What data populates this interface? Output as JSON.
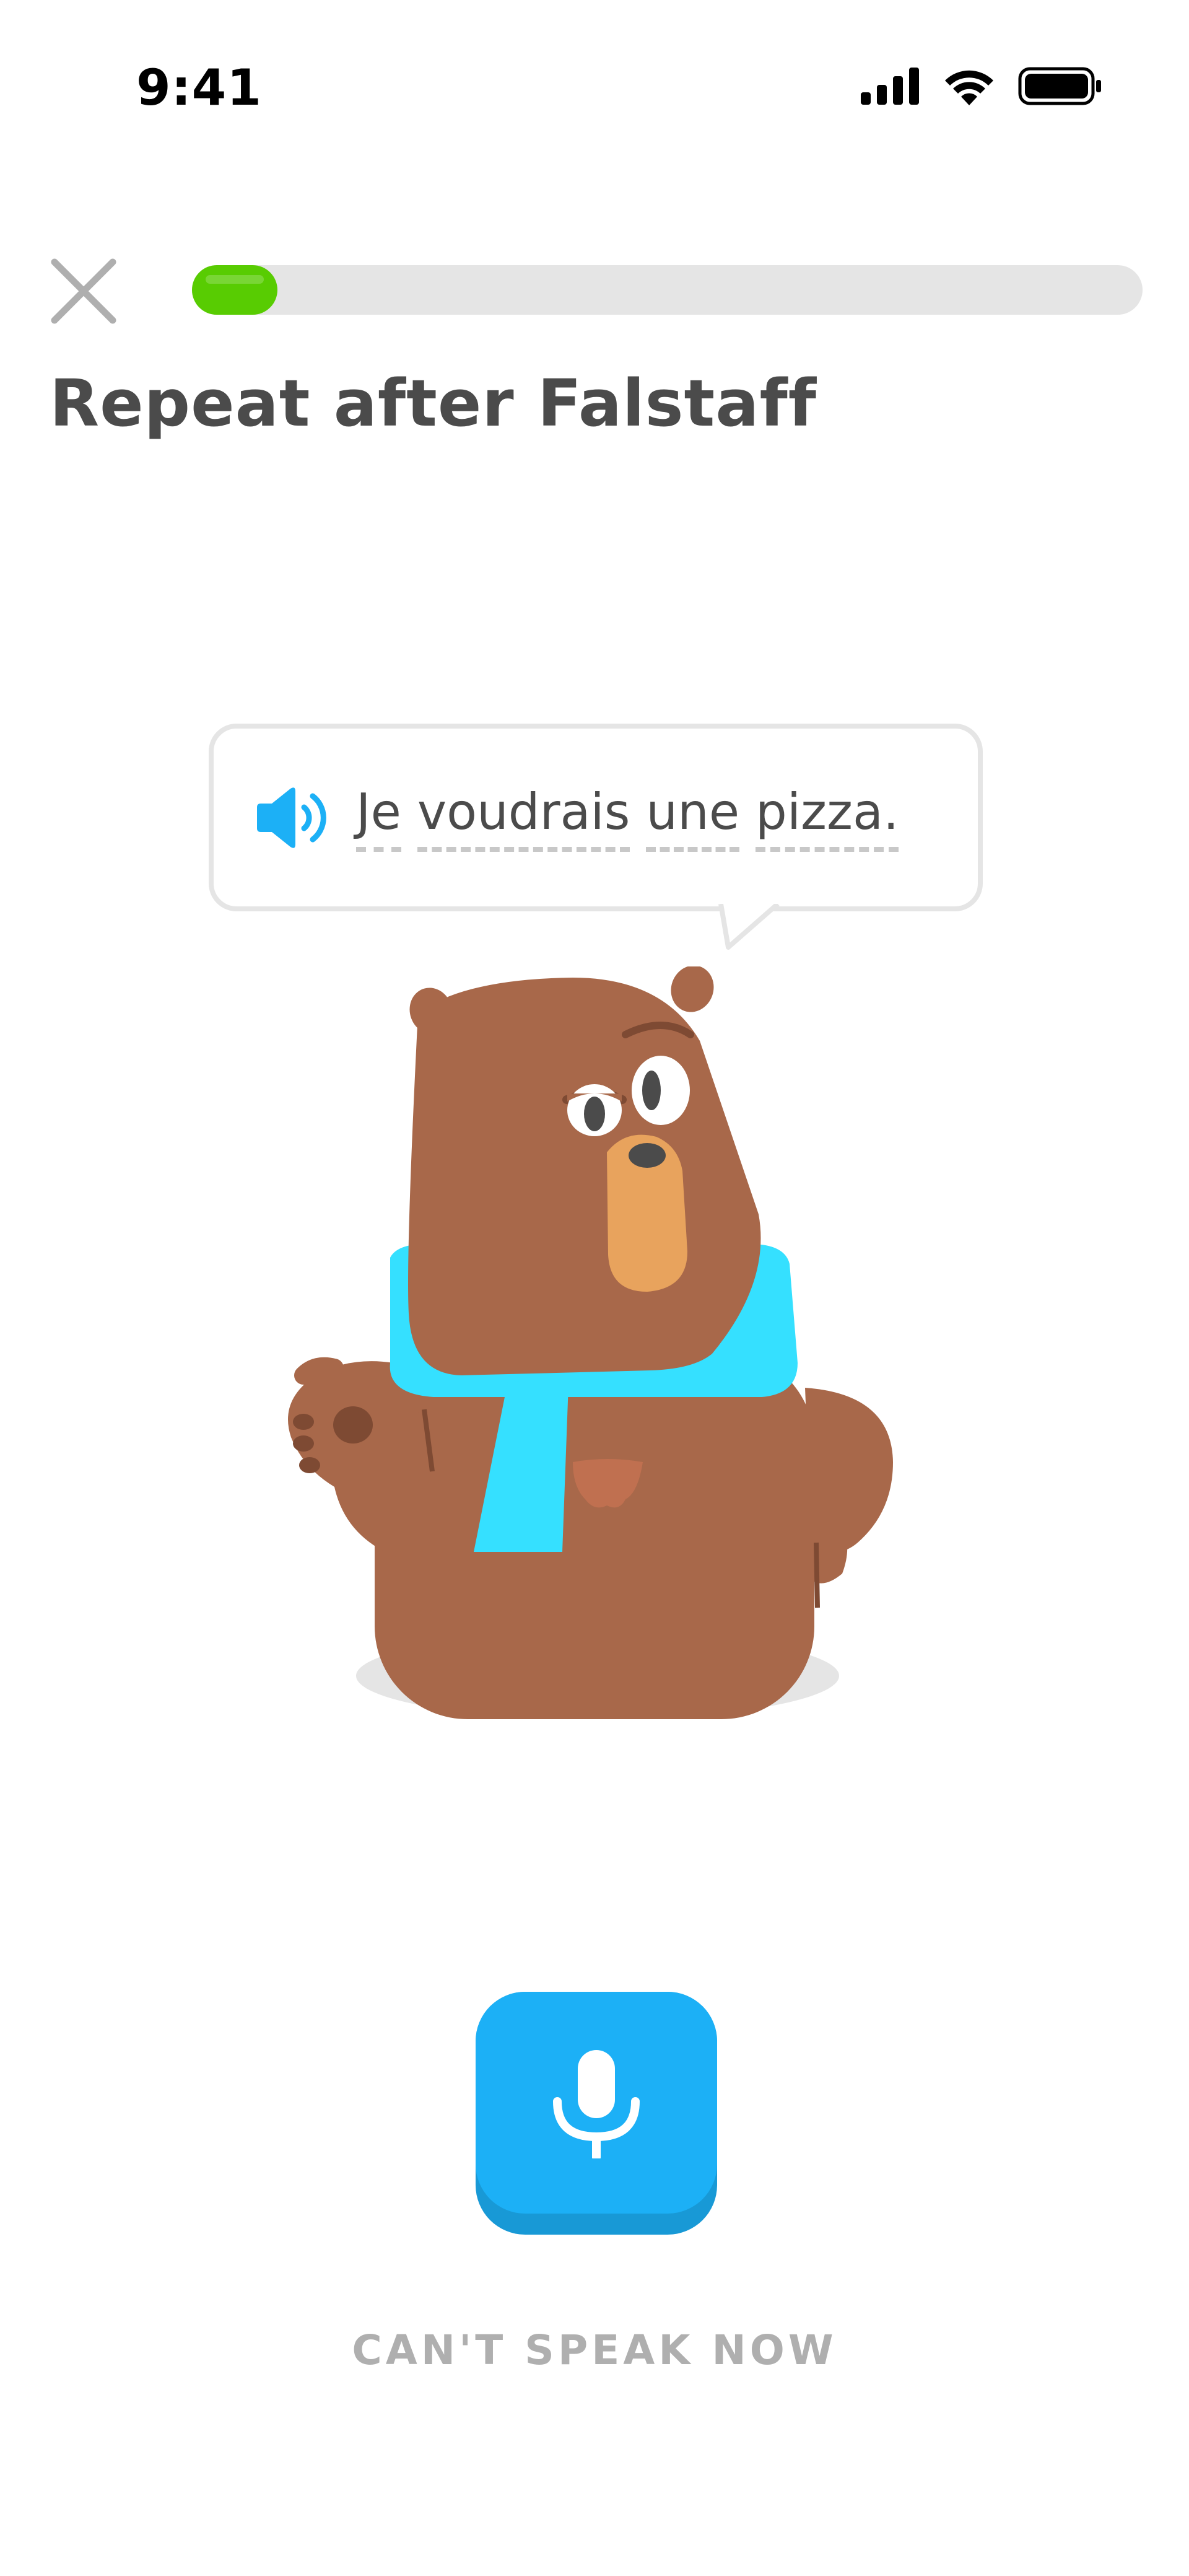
{
  "status_bar": {
    "time": "9:41"
  },
  "header": {
    "close_icon": "close-icon",
    "progress_percent": 9,
    "progress_color": "#58cc02",
    "title": "Repeat after Falstaff"
  },
  "prompt": {
    "speaker_icon": "speaker-icon",
    "words": [
      "Je",
      "voudrais",
      "une",
      "pizza."
    ]
  },
  "character": {
    "name": "Falstaff"
  },
  "actions": {
    "mic_icon": "microphone-icon",
    "mic_color": "#1cb0f6",
    "cant_speak_label": "CAN'T SPEAK NOW"
  }
}
